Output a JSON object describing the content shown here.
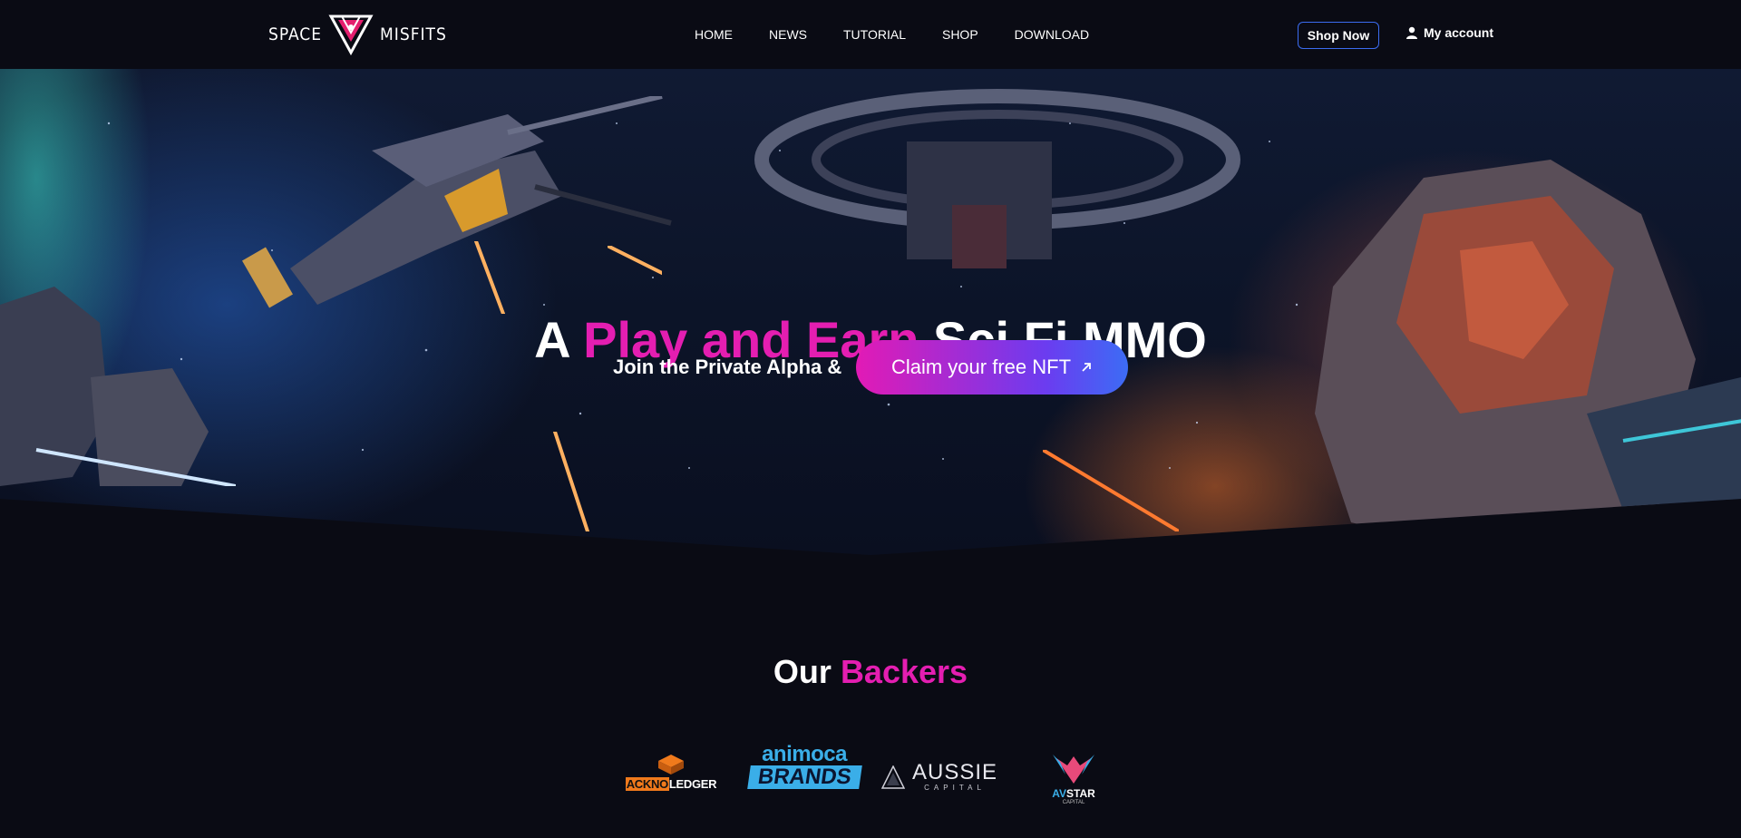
{
  "nav": {
    "logo_left": "SPACE",
    "logo_right": "MISFITS",
    "menu": [
      "HOME",
      "NEWS",
      "TUTORIAL",
      "SHOP",
      "DOWNLOAD"
    ],
    "shop_now": "Shop Now",
    "account": "My account"
  },
  "hero": {
    "title_a": "A ",
    "title_highlight": "Play and Earn",
    "title_b": " Sci Fi MMO",
    "subtitle": "Join the Private Alpha &",
    "cta": "Claim your free NFT"
  },
  "backers": {
    "title_a": "Our ",
    "title_highlight": "Backers",
    "acknoledger_a": "ACKNO",
    "acknoledger_b": "LEDGER",
    "animoca_1": "animoca",
    "animoca_2": "BRANDS",
    "aussie_1": "AUSSIE",
    "aussie_2": "CAPITAL",
    "avstar_a": "AV",
    "avstar_b": "STAR",
    "avstar_c": "CAPITAL"
  },
  "colors": {
    "accent_pink": "#e41eb1",
    "accent_blue": "#3b6cf0",
    "background": "#0a0b14"
  }
}
